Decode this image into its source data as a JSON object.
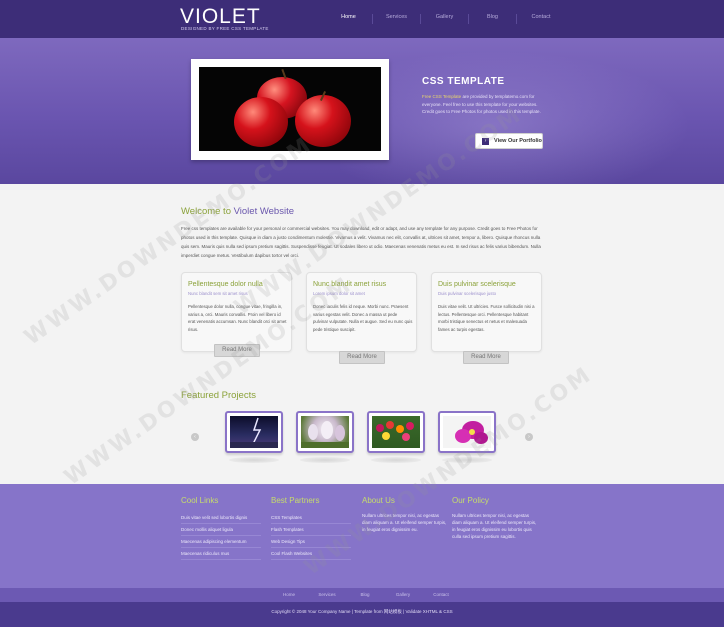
{
  "header": {
    "logo": "VIOLET",
    "tagline": "DESIGNED BY FREE CSS TEMPLATE",
    "nav": [
      "Home",
      "Services",
      "Gallery",
      "Blog",
      "Contact"
    ],
    "active_nav": "Home"
  },
  "banner": {
    "title": "CSS TEMPLATE",
    "text_highlight": "Free CSS Template",
    "text": " are provided by templatemo.com for everyone. Feel free to use this template for your websites. Credit goes to Free Photos for photos used in this template.",
    "button_label": "View Our Portfolio"
  },
  "welcome": {
    "title_prefix": "Welcome to ",
    "title_highlight": "Violet Website",
    "text": "Free css templates are available for your personal or commercial websites. You may download, edit or adapt, and use any template for any purpose. Credit goes to Free Photos for photos used in this template. Quisque in diam a justo condimentum molestie. Vivamus a velit. Vivamus nec elit, convallis at, ultrices sit amet, tempor a, libero. Quisque rhoncus nulla quis sem. Mauris quis nulla sed ipsum pretium sagittis. Suspendisse feugiat. Ut sodales libero ut odio. Maecenas venenatis metus eu est. In sed risus ac felis varius bibendum. Nulla imperdiet congue metus. Vestibulum dapibus tortor vel orci."
  },
  "cards": [
    {
      "title": "Pellentesque dolor nulla",
      "sub": "Nunc blandit sem sit amet risus",
      "text": "Pellentesque dolor nulla, congue vitae, fringilla in, varius a, orci. Mauris convallis. Proin vel libero id erat venenatis accumsan. Nunc blandit orci sit amet risus.",
      "button": "Read More"
    },
    {
      "title": "Nunc blandit amet risus",
      "sub": "Lorem ipsum dolor sit amet",
      "text": "Donec iaculis felis id neque. Morbi nunc. Praesent varius egestas velit. Donec a massa ut pede pulvinar vulputate. Nulla et augue. Sed eu nunc quis pede tristique suscipit.",
      "button": "Read More"
    },
    {
      "title": "Duis pulvinar scelerisque",
      "sub": "Duis pulvinar scelerisque justo",
      "text": "Duis vitae velit. Ut ultricies. Fusce sollicitudin nisi a lectus. Pellentesque orci. Pellentesque habitant morbi tristique senectus et netus et malesuada fames ac turpis egestas.",
      "button": "Read More"
    }
  ],
  "featured": {
    "title": "Featured Projects",
    "prev": "‹",
    "next": "›"
  },
  "footer": {
    "cool_links": {
      "title": "Cool Links",
      "items": [
        "Duis vitae velit sed lobortis dignis",
        "Donec mollis aliquet ligula",
        "Maecenas adipiscing elementum",
        "Maecenas ridiculus mus"
      ]
    },
    "best_partners": {
      "title": "Best Partners",
      "items": [
        "CSS Templates",
        "Flash Templates",
        "Web Design Tips",
        "Cool Flash Websites"
      ]
    },
    "about_us": {
      "title": "About Us",
      "text": "Nullam ultrices tempor nisi, ac egestas diam aliquam a. Ut eleifend semper turpis, in feugiat eros dignissim eu."
    },
    "our_policy": {
      "title": "Our Policy",
      "text": "Nullam ultrices tempor nisi, ac egestas diam aliquam a. Ut eleifend semper turpis, in feugiat eros dignissim eu lobortis quis culla sed ipsum pretium sagittis."
    }
  },
  "bottom_nav": [
    "Home",
    "Services",
    "Blog",
    "Gallery",
    "Contact"
  ],
  "copyright": "Copyright © 2048 Your Company Name | Template from 网站模板 | Validate XHTML & CSS",
  "watermark": "WWW.DOWNDEMO.COM",
  "colors": {
    "header": "#3d2d78",
    "banner": "#6a55b0",
    "accent_green": "#8ba23a",
    "footer": "#8674c9"
  }
}
